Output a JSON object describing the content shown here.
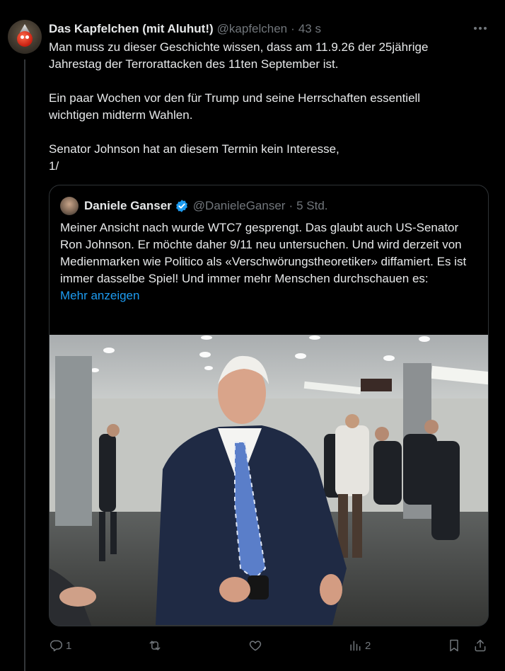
{
  "author": {
    "display_name": "Das Kapfelchen (mit Aluhut!)",
    "handle": "@kapfelchen",
    "separator": "·",
    "time": "43 s"
  },
  "body": {
    "lines": [
      "Man muss zu dieser Geschichte wissen, dass am 11.9.26 der 25jährige",
      "Jahrestag der Terrorattacken des 11ten September ist.",
      "",
      "Ein paar Wochen vor den für Trump und seine Herrschaften essentiell",
      "wichtigen midterm Wahlen.",
      "",
      "Senator Johnson hat an diesem Termin kein Interesse,",
      "1/"
    ]
  },
  "quote": {
    "display_name": "Daniele Ganser",
    "handle": "@DanieleGanser",
    "separator": "·",
    "time": "5 Std.",
    "text": "Meiner Ansicht nach wurde WTC7 gesprengt. Das glaubt auch US-Senator Ron Johnson. Er möchte daher 9/11 neu untersuchen. Und wird derzeit von Medienmarken wie Politico als «Verschwörungstheoretiker» diffamiert. Es ist immer dasselbe Spiel! Und immer mehr Menschen durchschauen es:",
    "show_more": "Mehr anzeigen"
  },
  "actions": {
    "reply_count": "1",
    "retweet_count": "",
    "like_count": "",
    "views_count": "2"
  },
  "icons": [
    "more-icon",
    "verified-icon",
    "reply-icon",
    "retweet-icon",
    "like-icon",
    "views-icon",
    "bookmark-icon",
    "share-icon"
  ],
  "colors": {
    "background": "#000000",
    "text": "#e7e9ea",
    "muted": "#71767b",
    "link": "#1d9bf0",
    "border": "#2f3336"
  }
}
